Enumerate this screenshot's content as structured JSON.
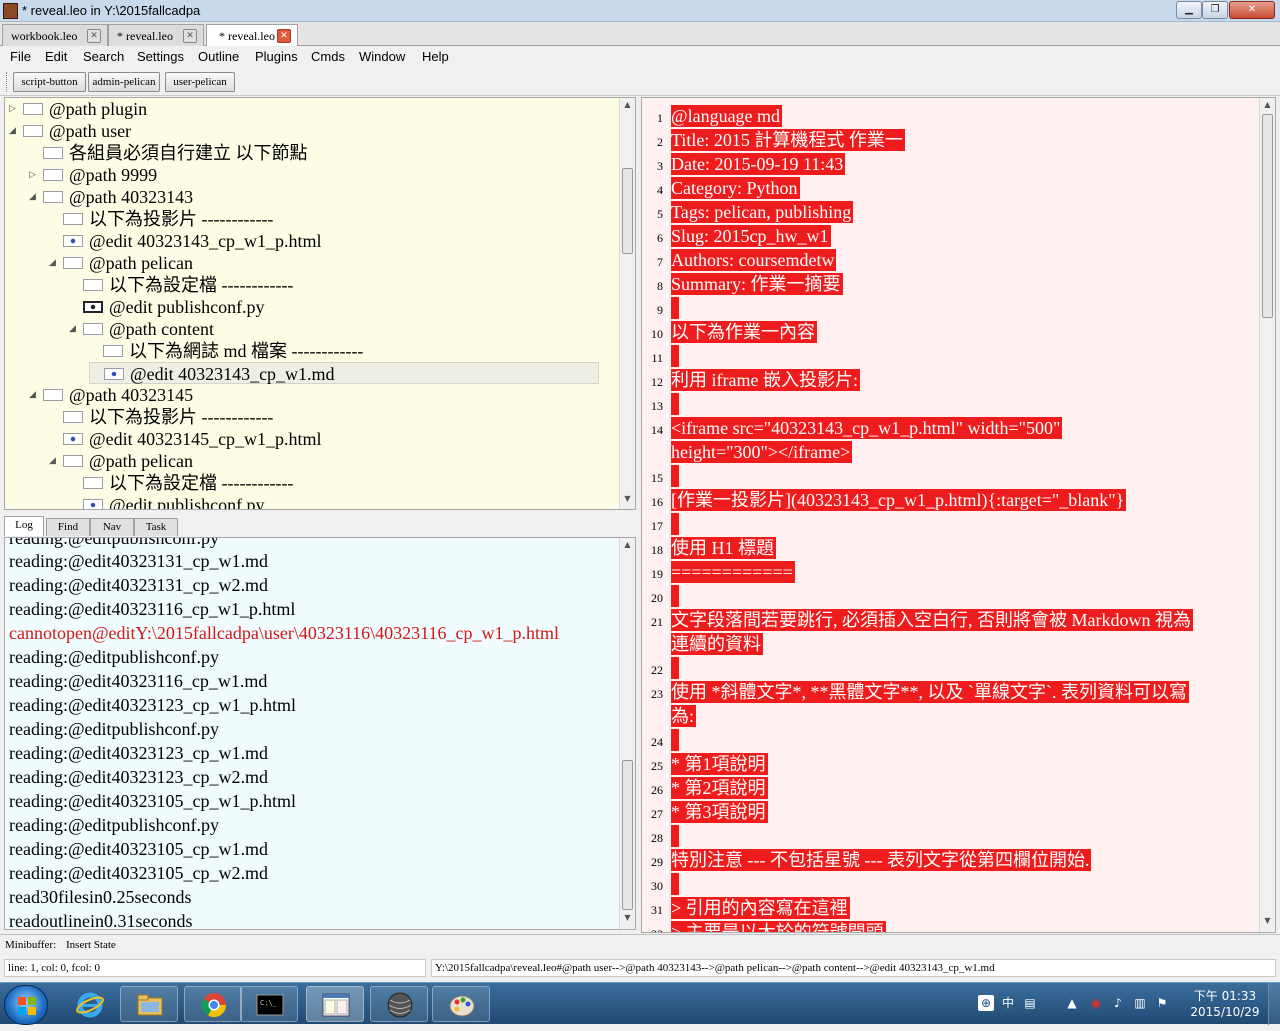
{
  "window": {
    "title": "* reveal.leo in Y:\\2015fallcadpa",
    "min_label": "▁",
    "max_label": "❐",
    "close_label": "✕"
  },
  "file_tabs": [
    {
      "label": "workbook.leo",
      "close": "✕"
    },
    {
      "label": "* reveal.leo",
      "close": "✕"
    },
    {
      "label": "* reveal.leo",
      "close": "✕"
    }
  ],
  "menu": [
    "File",
    "Edit",
    "Search",
    "Settings",
    "Outline",
    "Plugins",
    "Cmds",
    "Window",
    "Help"
  ],
  "toolbar": [
    "script-button",
    "admin-pelican",
    "user-pelican"
  ],
  "outline": [
    {
      "text": "@path plugin",
      "tri": "▷",
      "icon": "plain"
    },
    {
      "text": "@path user",
      "tri": "◢",
      "icon": "plain"
    },
    {
      "text": "各組員必須自行建立 以下節點",
      "tri": "",
      "icon": "plain"
    },
    {
      "text": "@path 9999",
      "tri": "▷",
      "icon": "plain"
    },
    {
      "text": "@path 40323143",
      "tri": "◢",
      "icon": "plain"
    },
    {
      "text": "以下為投影片 ------------",
      "tri": "",
      "icon": "plain"
    },
    {
      "text": "@edit 40323143_cp_w1_p.html",
      "tri": "",
      "icon": "dot"
    },
    {
      "text": "@path pelican",
      "tri": "◢",
      "icon": "plain"
    },
    {
      "text": "以下為設定檔 ------------",
      "tri": "",
      "icon": "plain"
    },
    {
      "text": "@edit publishconf.py",
      "tri": "",
      "icon": "dark"
    },
    {
      "text": "@path content",
      "tri": "◢",
      "icon": "plain"
    },
    {
      "text": "以下為網誌 md 檔案 ------------",
      "tri": "",
      "icon": "plain"
    },
    {
      "text": "@edit 40323143_cp_w1.md",
      "tri": "",
      "icon": "dot"
    },
    {
      "text": "@path 40323145",
      "tri": "◢",
      "icon": "plain"
    },
    {
      "text": "以下為投影片 ------------",
      "tri": "",
      "icon": "plain"
    },
    {
      "text": "@edit 40323145_cp_w1_p.html",
      "tri": "",
      "icon": "dot"
    },
    {
      "text": "@path pelican",
      "tri": "◢",
      "icon": "plain"
    },
    {
      "text": "以下為設定檔 ------------",
      "tri": "",
      "icon": "plain"
    },
    {
      "text": "@edit publishconf.py",
      "tri": "",
      "icon": "dot"
    }
  ],
  "body_lines": [
    {
      "n": "1",
      "text": "@language md"
    },
    {
      "n": "2",
      "text": "Title: 2015 計算機程式 作業一"
    },
    {
      "n": "3",
      "text": "Date: 2015-09-19 11:43"
    },
    {
      "n": "4",
      "text": "Category: Python"
    },
    {
      "n": "5",
      "text": "Tags: pelican, publishing"
    },
    {
      "n": "6",
      "text": "Slug: 2015cp_hw_w1"
    },
    {
      "n": "7",
      "text": "Authors: coursemdetw"
    },
    {
      "n": "8",
      "text": "Summary: 作業一摘要"
    },
    {
      "n": "9",
      "text": ""
    },
    {
      "n": "10",
      "text": "以下為作業一內容"
    },
    {
      "n": "11",
      "text": ""
    },
    {
      "n": "12",
      "text": "利用 iframe 嵌入投影片:"
    },
    {
      "n": "13",
      "text": ""
    },
    {
      "n": "14",
      "text": "<iframe src=\"40323143_cp_w1_p.html\" width=\"500\"",
      "cont": "height=\"300\"></iframe>"
    },
    {
      "n": "15",
      "text": ""
    },
    {
      "n": "16",
      "text": "[作業一投影片](40323143_cp_w1_p.html){:target=\"_blank\"}"
    },
    {
      "n": "17",
      "text": ""
    },
    {
      "n": "18",
      "text": "使用 H1 標題"
    },
    {
      "n": "19",
      "text": "============"
    },
    {
      "n": "20",
      "text": ""
    },
    {
      "n": "21",
      "text": "文字段落間若要跳行, 必須插入空白行, 否則將會被 Markdown 視為",
      "cont": "連續的資料"
    },
    {
      "n": "22",
      "text": ""
    },
    {
      "n": "23",
      "text": "使用 *斜體文字*, **黑體文字**, 以及 `單線文字`. 表列資料可以寫",
      "cont": "為:"
    },
    {
      "n": "24",
      "text": ""
    },
    {
      "n": "25",
      "text": " * 第1項說明"
    },
    {
      "n": "26",
      "text": " * 第2項說明"
    },
    {
      "n": "27",
      "text": " * 第3項說明"
    },
    {
      "n": "28",
      "text": ""
    },
    {
      "n": "29",
      "text": "特別注意 --- 不包括星號 --- 表列文字從第四欄位開始."
    },
    {
      "n": "30",
      "text": ""
    },
    {
      "n": "31",
      "text": "> 引用的內容寫在這裡"
    },
    {
      "n": "32",
      "text": "> 主要是以大於的符號開頭"
    }
  ],
  "log_tabs": [
    "Log",
    "Find",
    "Nav",
    "Task"
  ],
  "log_lines": [
    {
      "text": "reading:@editpublishconf.py",
      "err": false
    },
    {
      "text": "reading:@edit40323131_cp_w1.md",
      "err": false
    },
    {
      "text": "reading:@edit40323131_cp_w2.md",
      "err": false
    },
    {
      "text": "reading:@edit40323116_cp_w1_p.html",
      "err": false
    },
    {
      "text": "cannotopen@editY:\\2015fallcadpa\\user\\40323116\\40323116_cp_w1_p.html",
      "err": true
    },
    {
      "text": "reading:@editpublishconf.py",
      "err": false
    },
    {
      "text": "reading:@edit40323116_cp_w1.md",
      "err": false
    },
    {
      "text": "reading:@edit40323123_cp_w1_p.html",
      "err": false
    },
    {
      "text": "reading:@editpublishconf.py",
      "err": false
    },
    {
      "text": "reading:@edit40323123_cp_w1.md",
      "err": false
    },
    {
      "text": "reading:@edit40323123_cp_w2.md",
      "err": false
    },
    {
      "text": "reading:@edit40323105_cp_w1_p.html",
      "err": false
    },
    {
      "text": "reading:@editpublishconf.py",
      "err": false
    },
    {
      "text": "reading:@edit40323105_cp_w1.md",
      "err": false
    },
    {
      "text": "reading:@edit40323105_cp_w2.md",
      "err": false
    },
    {
      "text": "read30filesin0.25seconds",
      "err": false
    },
    {
      "text": "readoutlinein0.31seconds",
      "err": false
    }
  ],
  "minibuffer": {
    "label": "Minibuffer:",
    "state": "Insert State"
  },
  "status": {
    "position": "line: 1, col: 0, fcol: 0",
    "path": "Y:\\2015fallcadpa\\reveal.leo#@path user-->@path 40323143-->@path pelican-->@path content-->@edit 40323143_cp_w1.md"
  },
  "taskbar": {
    "apps": [
      "ie-icon",
      "explorer-icon",
      "chrome-icon",
      "cmd-icon",
      "leo-icon",
      "sphere-icon",
      "paint-icon"
    ],
    "tray": {
      "ime": "中",
      "time": "下午 01:33",
      "date": "2015/10/29"
    }
  },
  "colors": {
    "outline_bg": "#fdfde6",
    "body_bg": "#fff0f0",
    "highlight": "#ee1c1c",
    "log_bg": "#f0fbfd",
    "error": "#d01818"
  }
}
